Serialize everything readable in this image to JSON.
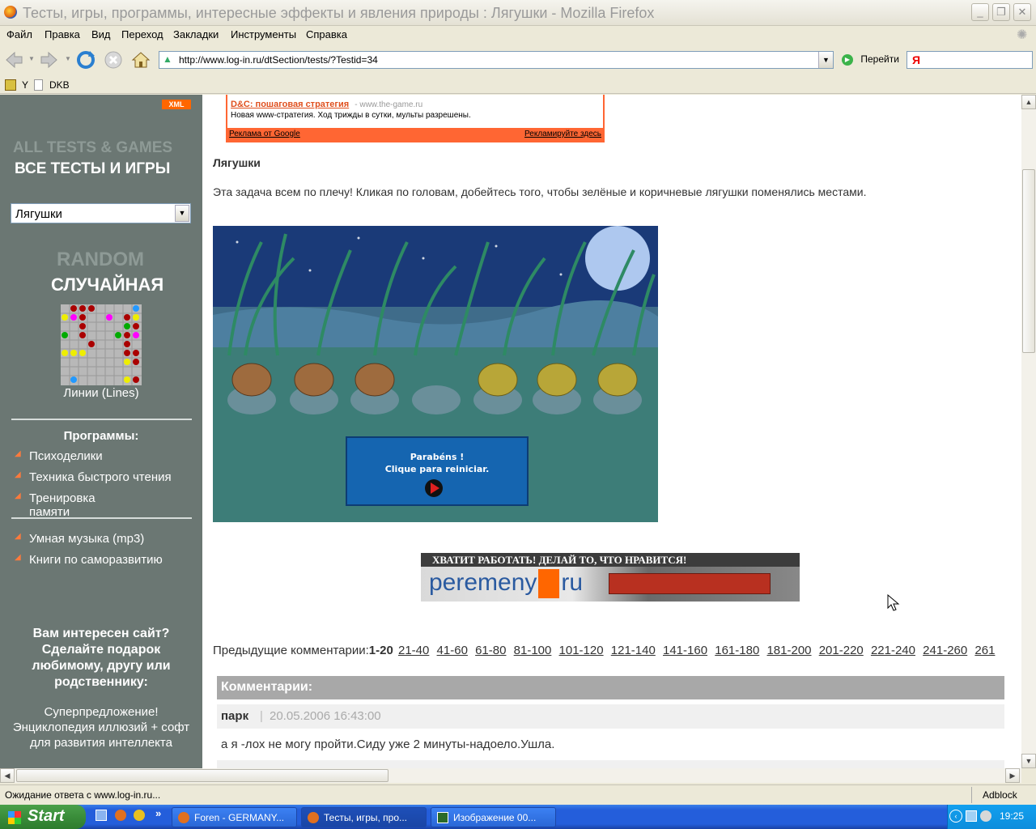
{
  "window": {
    "title": "Тесты, игры, программы, интересные эффекты и явления природы : Лягушки - Mozilla Firefox"
  },
  "menu": [
    "Файл",
    "Правка",
    "Вид",
    "Переход",
    "Закладки",
    "Инструменты",
    "Справка"
  ],
  "toolbar": {
    "url": "http://www.log-in.ru/dtSection/tests/?Testid=34",
    "go_label": "Перейти",
    "yandex_label": "Я"
  },
  "bookmarks": [
    "Y",
    "DKB"
  ],
  "sidebar": {
    "xml_badge": "XML",
    "all_tests_en": "ALL TESTS & GAMES",
    "all_tests_ru": "ВСЕ ТЕСТЫ И ИГРЫ",
    "select_value": "Лягушки",
    "random_en": "RANDOM",
    "random_ru": "СЛУЧАЙНАЯ",
    "random_game_label": "Линии (Lines)",
    "programs_heading": "Программы:",
    "programs": [
      "Психоделики",
      "Техника быстрого чтения",
      "Тренировка памяти"
    ],
    "extras": [
      "Умная музыка (mp3)",
      "Книги по саморазвитию"
    ],
    "promo_heading": "Вам интересен сайт? Сделайте подарок любимому, другу или родственнику:",
    "promo_text": "Суперпредложение! Энциклопедия иллюзий + софт для развития интеллекта"
  },
  "ad": {
    "title": "D&C: пошаговая стратегия",
    "domain": "- www.the-game.ru",
    "text": "Новая www-стратегия. Ход трижды в сутки, мульты разрешены.",
    "left_link": "Реклама от Google",
    "right_link": "Рекламируйте здесь"
  },
  "main": {
    "heading": "Лягушки",
    "description": "Эта задача всем по плечу! Кликая по головам, добейтесь того, чтобы зелёные и коричневые лягушки поменялись местами.",
    "game_msg_line1": "Parabéns !",
    "game_msg_line2": "Clique para reiniciar.",
    "banner_top": "ХВАТИТ РАБОТАТЬ! ДЕЛАЙ ТО, ЧТО НРАВИТСЯ!",
    "banner_brand_left": "peremeny",
    "banner_brand_right": "ru",
    "pager_label": "Предыдущие комментарии:",
    "pager_current": "1-20",
    "pager_links": [
      "21-40",
      "41-60",
      "61-80",
      "81-100",
      "101-120",
      "121-140",
      "141-160",
      "161-180",
      "181-200",
      "201-220",
      "221-240",
      "241-260",
      "261"
    ],
    "comments_header": "Комментарии:",
    "comments": [
      {
        "author": "парк",
        "sep": "|",
        "date": "20.05.2006 16:43:00",
        "text": "а я -лох не могу пройти.Сиду уже 2 минуты-надоело.Ушла."
      }
    ]
  },
  "status": {
    "text": "Ожидание ответа с www.log-in.ru...",
    "adblock": "Adblock"
  },
  "taskbar": {
    "start": "Start",
    "tasks": [
      "Foren - GERMANY...",
      "Тесты, игры, про...",
      "Изображение 00..."
    ],
    "clock": "19:25"
  },
  "colors": {
    "sidebar_bg": "#6b7773",
    "ad_border": "#ff6633",
    "link_orange": "#e0501e",
    "pond_bg": "#3d7d78"
  }
}
